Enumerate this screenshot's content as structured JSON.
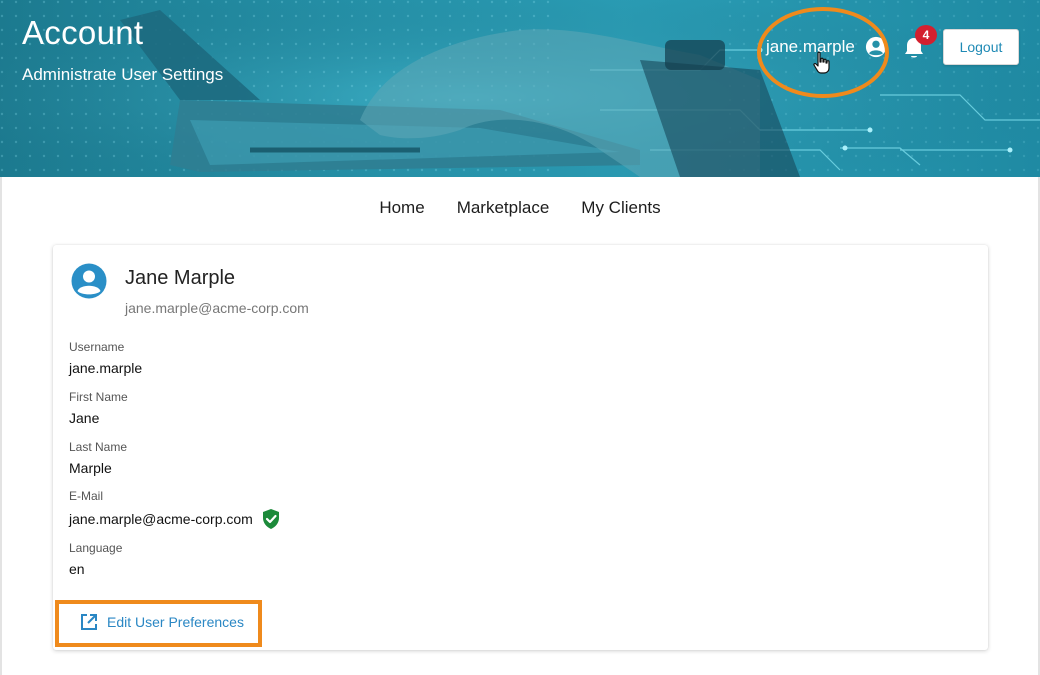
{
  "header": {
    "title": "Account",
    "subtitle": "Administrate User Settings",
    "username": "jane.marple",
    "notification_count": "4",
    "logout_label": "Logout",
    "banner_color": "#2591a8",
    "highlight_color": "#ef8a1c"
  },
  "nav": {
    "items": [
      {
        "label": "Home"
      },
      {
        "label": "Marketplace"
      },
      {
        "label": "My Clients"
      }
    ]
  },
  "profile": {
    "full_name": "Jane Marple",
    "email": "jane.marple@acme-corp.com",
    "fields": {
      "username": {
        "label": "Username",
        "value": "jane.marple"
      },
      "first_name": {
        "label": "First Name",
        "value": "Jane"
      },
      "last_name": {
        "label": "Last Name",
        "value": "Marple"
      },
      "email": {
        "label": "E-Mail",
        "value": "jane.marple@acme-corp.com",
        "verified_icon": "shield-check-icon"
      },
      "language": {
        "label": "Language",
        "value": "en"
      }
    },
    "edit_link_label": "Edit User Preferences",
    "edit_link_icon": "external-link-icon",
    "link_color": "#2a87c4"
  }
}
